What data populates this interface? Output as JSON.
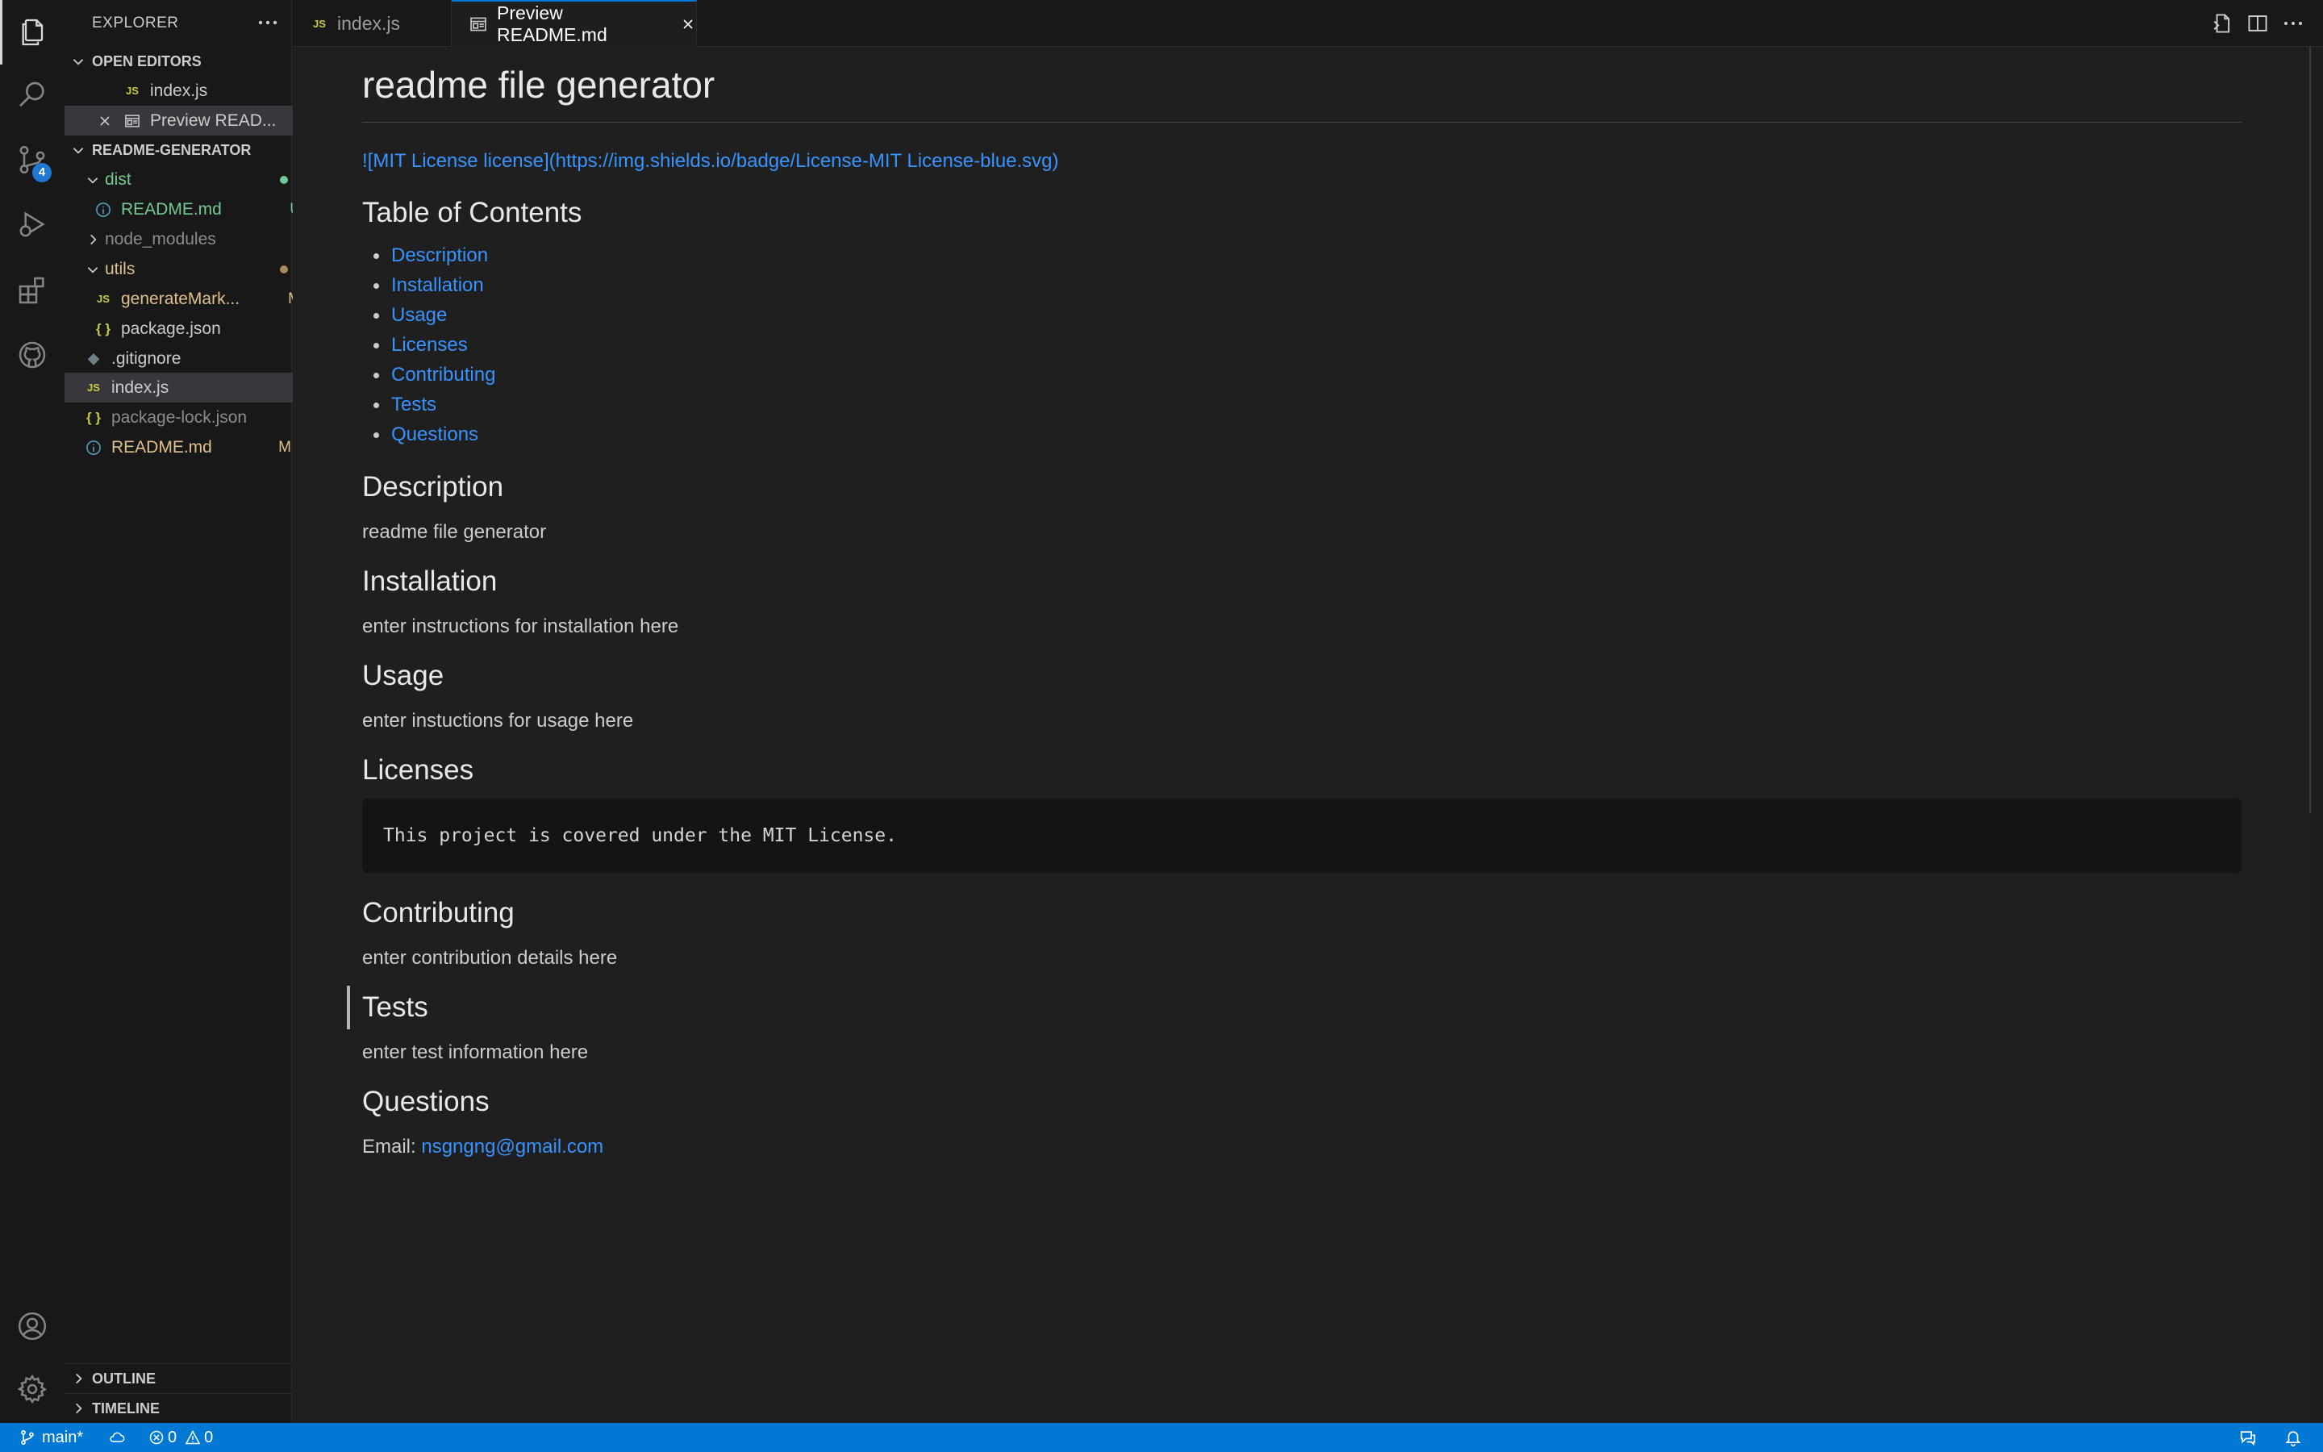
{
  "activity_bar": {
    "items": [
      {
        "name": "explorer",
        "icon": "files-icon",
        "active": true
      },
      {
        "name": "search",
        "icon": "search-icon"
      },
      {
        "name": "source-control",
        "icon": "source-control-icon",
        "badge": "4"
      },
      {
        "name": "run-debug",
        "icon": "run-debug-icon"
      },
      {
        "name": "extensions",
        "icon": "extensions-icon"
      },
      {
        "name": "github",
        "icon": "github-icon"
      }
    ],
    "bottom": [
      {
        "name": "accounts",
        "icon": "account-icon"
      },
      {
        "name": "manage",
        "icon": "gear-icon"
      }
    ]
  },
  "sidebar": {
    "title": "EXPLORER",
    "open_editors": {
      "header": "OPEN EDITORS",
      "items": [
        {
          "icon": "JS",
          "label": "index.js"
        },
        {
          "icon": "preview",
          "label": "Preview READ..."
        }
      ]
    },
    "project": {
      "header": "README-GENERATOR",
      "items": [
        {
          "label": "dist",
          "status": "dot"
        },
        {
          "label": "README.md",
          "status": "U"
        },
        {
          "label": "node_modules"
        },
        {
          "label": "utils",
          "status": "dot"
        },
        {
          "label": "generateMark...",
          "status": "M",
          "icon": "JS"
        },
        {
          "label": "package.json",
          "icon": "{ }"
        },
        {
          "label": ".gitignore",
          "icon": "◆"
        },
        {
          "label": "index.js",
          "icon": "JS"
        },
        {
          "label": "package-lock.json",
          "icon": "{ }"
        },
        {
          "label": "README.md",
          "status": "M"
        }
      ]
    },
    "outline": "OUTLINE",
    "timeline": "TIMELINE"
  },
  "tabs": [
    {
      "icon": "JS",
      "label": "index.js",
      "active": false
    },
    {
      "icon": "preview",
      "label": "Preview README.md",
      "active": true
    }
  ],
  "preview": {
    "title": "readme file generator",
    "badge_text": "![MIT License license](https://img.shields.io/badge/License-MIT License-blue.svg)",
    "toc_heading": "Table of Contents",
    "toc": [
      "Description",
      "Installation",
      "Usage",
      "Licenses",
      "Contributing",
      "Tests",
      "Questions"
    ],
    "sections": {
      "description": {
        "heading": "Description",
        "text": "readme file generator"
      },
      "installation": {
        "heading": "Installation",
        "text": "enter instructions for installation here"
      },
      "usage": {
        "heading": "Usage",
        "text": "enter instuctions for usage here"
      },
      "licenses": {
        "heading": "Licenses",
        "code": "This project is covered under the MIT License."
      },
      "contributing": {
        "heading": "Contributing",
        "text": "enter contribution details here"
      },
      "tests": {
        "heading": "Tests",
        "text": "enter test information here"
      },
      "questions": {
        "heading": "Questions",
        "email_label": "Email:",
        "email": "nsgngng@gmail.com"
      }
    }
  },
  "status_bar": {
    "branch": "main*",
    "errors": "0",
    "warnings": "0"
  },
  "colors": {
    "accent": "#0078d4",
    "link": "#3794ff",
    "untracked": "#73c991",
    "modified": "#e2c08d",
    "js_icon": "#cbcb41"
  }
}
